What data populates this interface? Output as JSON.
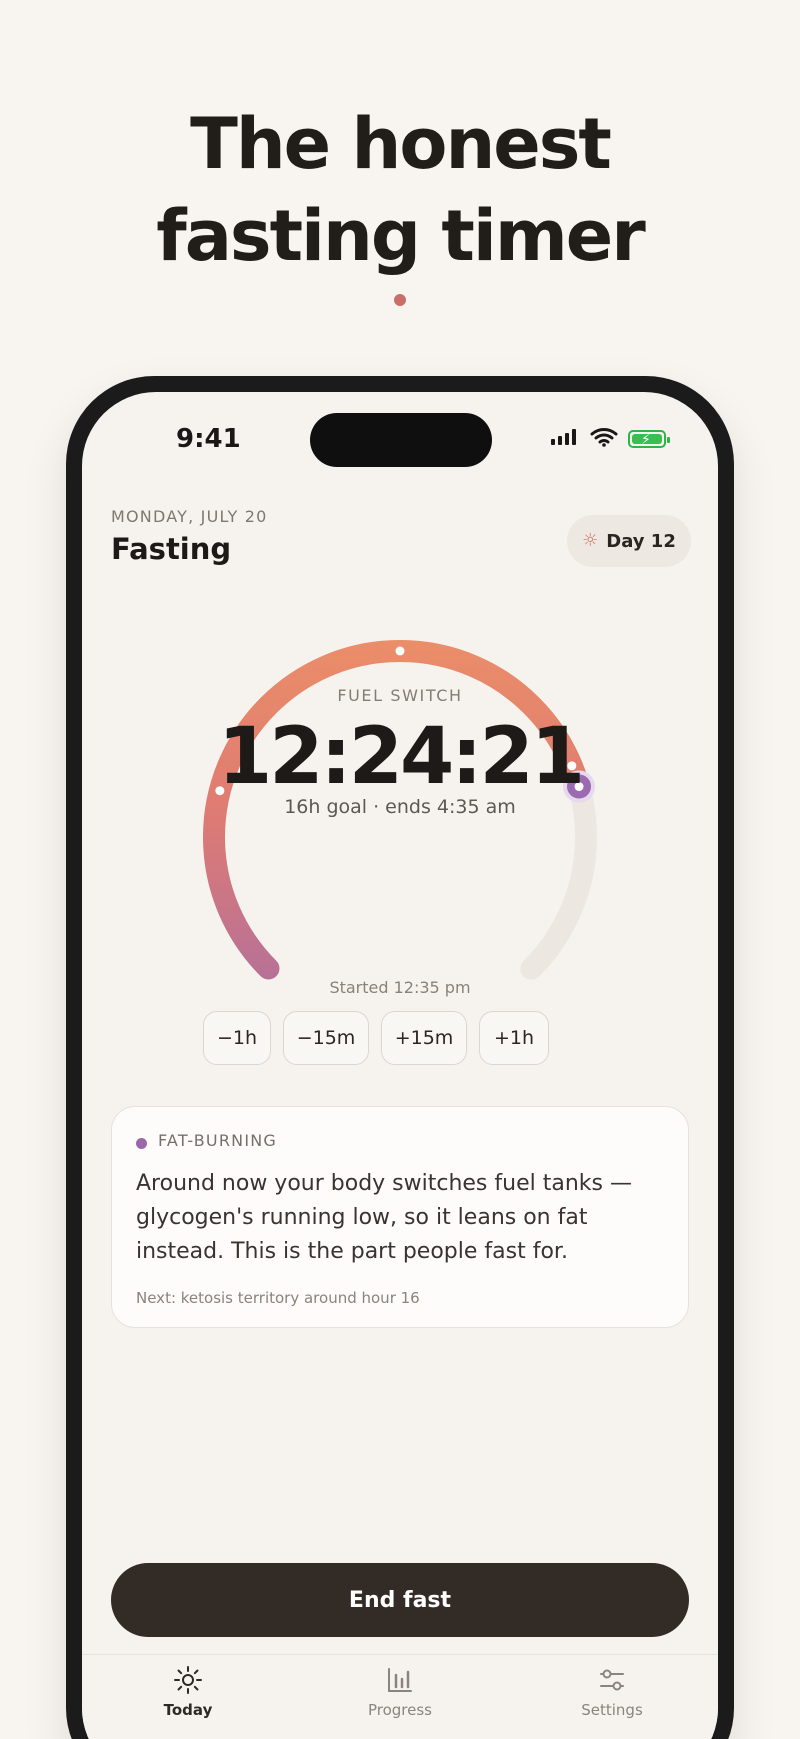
{
  "headline": {
    "line1": "The honest",
    "line2": "fasting timer"
  },
  "status_bar": {
    "time": "9:41",
    "icons": [
      "signal-icon",
      "wifi-icon",
      "battery-icon"
    ]
  },
  "header": {
    "date": "MONDAY, JULY 20",
    "title": "Fasting",
    "day_badge": "Day 12",
    "day_icon": "sun-icon"
  },
  "timer": {
    "phase_label": "FUEL SWITCH",
    "elapsed": "12:24:21",
    "subtitle": "16h goal · ends 4:35 am",
    "progress_fraction": 0.775
  },
  "start_info": {
    "label": "Started 12:35 pm"
  },
  "adjust_buttons": [
    "−1h",
    "−15m",
    "+15m",
    "+1h"
  ],
  "phase_card": {
    "label": "FAT-BURNING",
    "body": "Around now your body switches fuel tanks — glycogen's running low, so it leans on fat instead. This is the part people fast for.",
    "next": "Next: ketosis territory around hour 16",
    "dot_color": "#9a68a8"
  },
  "actions": {
    "end_fast": "End fast"
  },
  "tabs": [
    {
      "label": "Today",
      "icon": "sun-icon",
      "active": true
    },
    {
      "label": "Progress",
      "icon": "bar-chart-icon",
      "active": false
    },
    {
      "label": "Settings",
      "icon": "sliders-icon",
      "active": false
    }
  ],
  "colors": {
    "background": "#f8f5f0",
    "accent": "#c86f68",
    "progress_start": "#ef9564",
    "progress_end": "#9b6ab0",
    "button_dark": "#322b26"
  }
}
